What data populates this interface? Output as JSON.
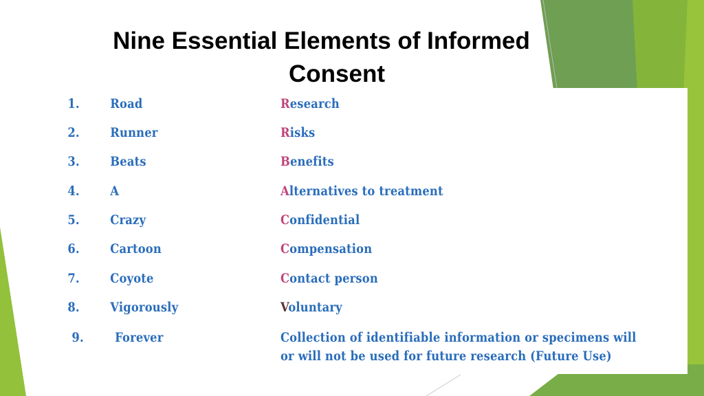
{
  "slide": {
    "title_line1": "Nine Essential Elements of Informed",
    "title_line2": "Consent",
    "colors": {
      "list_text": "#2a6dbb",
      "first_letter": "#c04478",
      "first_letter_v": "#5a3038",
      "green_dark": "#6b9e4e",
      "green_light": "#8dbf2e"
    },
    "items": [
      {
        "num": "1.",
        "word": "Road",
        "first": "R",
        "rest": "esearch"
      },
      {
        "num": "2.",
        "word": "Runner",
        "first": "R",
        "rest": "isks"
      },
      {
        "num": "3.",
        "word": "Beats",
        "first": "B",
        "rest": "enefits"
      },
      {
        "num": "4.",
        "word": "A",
        "first": "A",
        "rest": "lternatives to treatment"
      },
      {
        "num": "5.",
        "word": "Crazy",
        "first": "C",
        "rest": "onfidential"
      },
      {
        "num": "6.",
        "word": "Cartoon",
        "first": "C",
        "rest": "ompensation"
      },
      {
        "num": "7.",
        "word": "Coyote",
        "first": "C",
        "rest": "ontact person"
      },
      {
        "num": "8.",
        "word": "Vigorously",
        "first": "V",
        "rest": "oluntary"
      },
      {
        "num": "9.",
        "word": "Forever",
        "line1": "Collection of identifiable information or specimens will",
        "line2": "or will not be used for future research (Future Use)"
      }
    ]
  }
}
